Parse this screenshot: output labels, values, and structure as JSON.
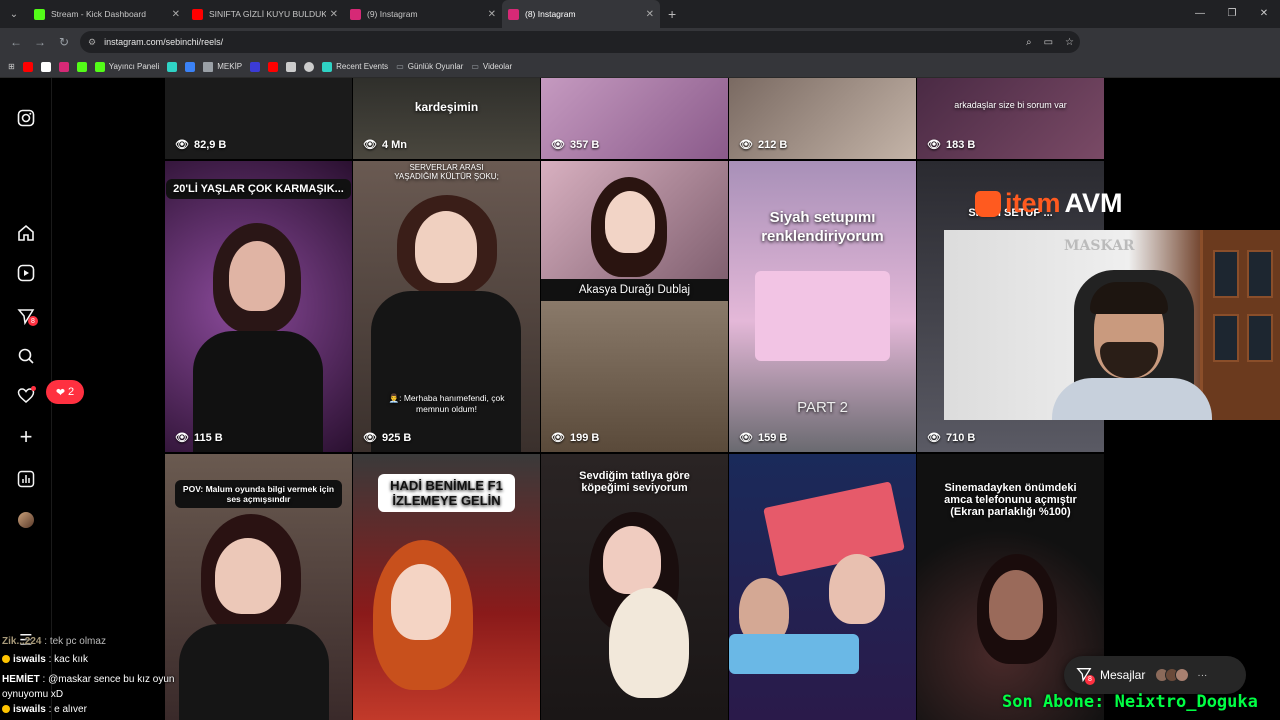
{
  "browser": {
    "tabs": [
      {
        "title": "Stream - Kick Dashboard",
        "favicon_color": "#53fc18"
      },
      {
        "title": "SINIFTA GİZLİ KUYU BULDUK! 🫢",
        "favicon_color": "#ff0000"
      },
      {
        "title": "(9) Instagram",
        "favicon_color": "#d62976"
      },
      {
        "title": "(8) Instagram",
        "favicon_color": "#d62976"
      }
    ],
    "url": "instagram.com/sebinchi/reels/",
    "bookmarks": [
      {
        "label": "",
        "color": "#ff0000"
      },
      {
        "label": "",
        "color": "#ffffff"
      },
      {
        "label": "",
        "color": "#d62976"
      },
      {
        "label": "",
        "color": "#53fc18"
      },
      {
        "label": "Yayıncı Paneli",
        "color": "#53fc18"
      },
      {
        "label": "",
        "color": "#2fd3c5"
      },
      {
        "label": "",
        "color": "#3b82f6"
      },
      {
        "label": "MEKİP",
        "color": "#9aa0a6"
      },
      {
        "label": "",
        "color": "#3b3bd6"
      },
      {
        "label": "",
        "color": "#ff0000"
      },
      {
        "label": "",
        "color": "#cccccc"
      },
      {
        "label": "",
        "color": "#cccccc"
      },
      {
        "label": "Recent Events",
        "color": "#2fd3c5"
      },
      {
        "label": "Günlük Oyunlar",
        "color": "#9aa0a6"
      },
      {
        "label": "Videolar",
        "color": "#9aa0a6"
      }
    ]
  },
  "sidebar": {
    "messages_badge": "8",
    "notification_count": "2"
  },
  "reels": [
    {
      "views": "82,9 B",
      "caption": "",
      "bg": "#1b1b1b"
    },
    {
      "views": "4 Mn",
      "caption": "kardeşimin",
      "bg": "#3a3a36"
    },
    {
      "views": "357 B",
      "caption": "",
      "bg": "#a57aa0"
    },
    {
      "views": "212 B",
      "caption": "",
      "bg": "#8a7a70"
    },
    {
      "views": "183 B",
      "caption": "arkadaşlar size bi sorum var",
      "bg": "#5a3a50"
    },
    {
      "views": "115 B",
      "caption": "20'Lİ YAŞLAR ÇOK KARMAŞIK...",
      "bg": "#4a2a5a"
    },
    {
      "views": "925 B",
      "caption": "SERVERLAR ARASI YAŞADIĞIM KÜLTÜR ŞOKU;",
      "bg": "#5a4a44",
      "sub": "👨‍💼: Merhaba hanımefendi, çok memnun oldum!"
    },
    {
      "views": "199 B",
      "caption": "Akasya Durağı Dublaj",
      "bg": "#b59098"
    },
    {
      "views": "159 B",
      "caption": "Siyah setupımı renklendiriyorum",
      "bg": "#b78ca8",
      "sub": "PART 2"
    },
    {
      "views": "710 B",
      "caption": "SİYAH SETUP ...",
      "bg": "#3a3a40"
    },
    {
      "views": "",
      "caption": "POV: Malum oyunda bilgi vermek için ses açmışsındır",
      "bg": "#4a3a3a"
    },
    {
      "views": "",
      "caption": "HADİ BENİMLE F1 İZLEMEYE GELİN",
      "bg": "#6a1a1a"
    },
    {
      "views": "",
      "caption": "Sevdiğim tatlıya göre köpeğimi seviyorum",
      "bg": "#2a2626"
    },
    {
      "views": "",
      "caption": "",
      "bg": "#1a2a5a"
    },
    {
      "views": "",
      "caption": "Sinemadayken önümdeki amca telefonunu açmıştır (Ekran parlaklığı %100)",
      "bg": "#111111"
    }
  ],
  "overlay": {
    "brand_item": "item",
    "brand_avm": "AVM",
    "webcam_wall_text": "MASKAR",
    "sub_banner": "Son Abone: Neixtro_Doguka"
  },
  "chat": [
    {
      "user": "Zik...224",
      "msg": "tek pc olmaz",
      "dim": true
    },
    {
      "user": "iswails",
      "msg": "kac kıık",
      "badge": true
    },
    {
      "user": "HEMİET",
      "msg": "@maskar sence bu kız oyun oynuyomu xD",
      "badge": false
    },
    {
      "user": "iswails",
      "msg": "e alıver",
      "badge": true
    }
  ],
  "messages_button": {
    "label": "Mesajlar",
    "badge": "8"
  }
}
